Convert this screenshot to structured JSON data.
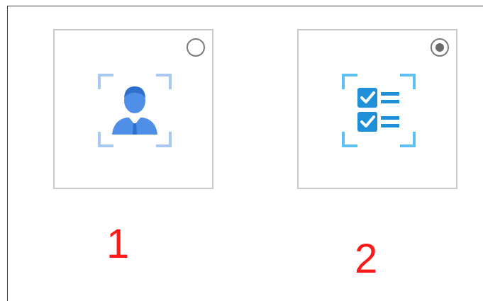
{
  "options": [
    {
      "id": "face-recognition",
      "icon": "face-scan-icon",
      "selected": false,
      "number": "1",
      "colors": {
        "frame": "#a8c8f0",
        "figure": "#4f8fe8",
        "figure_dark": "#2f6fd0"
      }
    },
    {
      "id": "checklist",
      "icon": "checklist-scan-icon",
      "selected": true,
      "number": "2",
      "colors": {
        "frame": "#5ec0f0",
        "box": "#1f8fd8",
        "lines": "#1f8fd8"
      }
    }
  ],
  "colors": {
    "card_border": "#c9c9c9",
    "radio_border": "#7a7a7a",
    "radio_dot": "#6b6b6b",
    "annotation": "#ff1a1a"
  }
}
